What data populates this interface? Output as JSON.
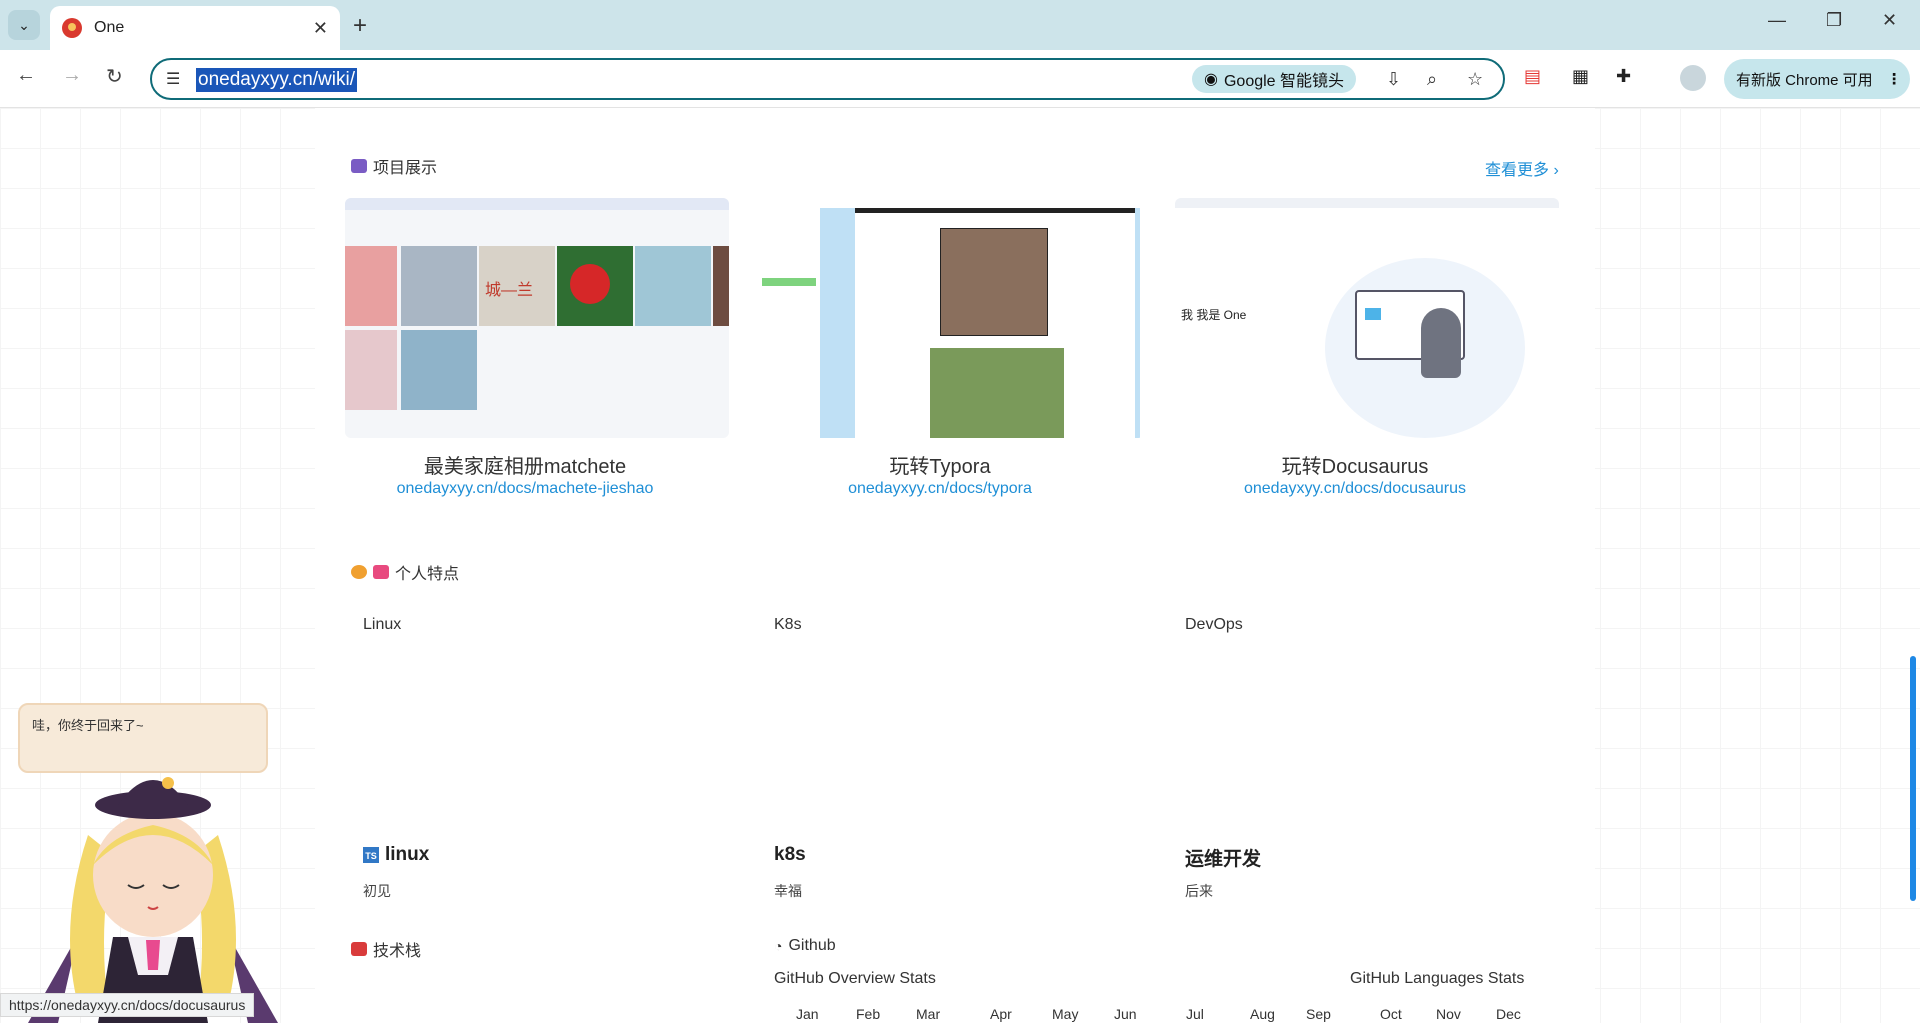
{
  "browser": {
    "tab_title": "One",
    "url": "onedayxyy.cn/wiki/",
    "lens_label": "Google 智能镜头",
    "update_label": "有新版 Chrome 可用",
    "status_url": "https://onedayxyy.cn/docs/docusaurus"
  },
  "projects": {
    "heading": "项目展示",
    "more": "查看更多 ›",
    "cards": [
      {
        "title": "最美家庭相册matchete",
        "link": "onedayxyy.cn/docs/machete-jieshao"
      },
      {
        "title": "玩转Typora",
        "link": "onedayxyy.cn/docs/typora"
      },
      {
        "title": "玩转Docusaurus",
        "link": "onedayxyy.cn/docs/docusaurus"
      }
    ]
  },
  "features": {
    "heading": "个人特点",
    "items": [
      {
        "alt": "Linux",
        "title": "linux",
        "desc": "初见"
      },
      {
        "alt": "K8s",
        "title": "k8s",
        "desc": "幸福"
      },
      {
        "alt": "DevOps",
        "title": "运维开发",
        "desc": "后来"
      }
    ]
  },
  "stack": {
    "heading": "技术栈"
  },
  "github": {
    "heading": "Github",
    "overview_alt": "GitHub Overview Stats",
    "languages_alt": "GitHub Languages Stats",
    "months": [
      "Jan",
      "Feb",
      "Mar",
      "Apr",
      "May",
      "Jun",
      "Jul",
      "Aug",
      "Sep",
      "Oct",
      "Nov",
      "Dec"
    ]
  },
  "mascot": {
    "speech": "哇，你终于回来了~"
  },
  "thumb_texts": {
    "card1_banner": "城—兰",
    "card3_greeting": "我 我是 One"
  }
}
